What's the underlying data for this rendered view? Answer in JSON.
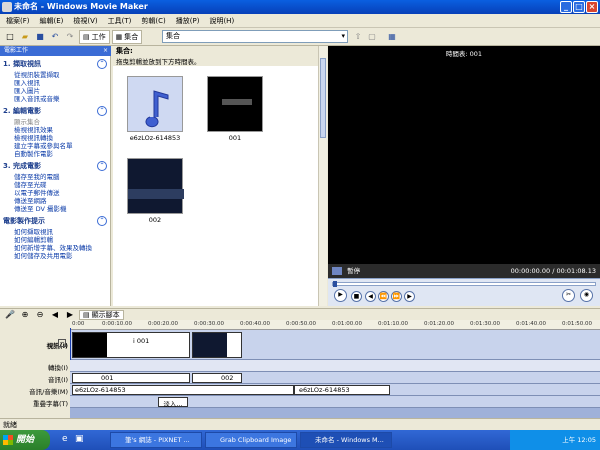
{
  "window": {
    "title": "未命名 - Windows Movie Maker"
  },
  "menu": [
    "檔案(F)",
    "編輯(E)",
    "檢視(V)",
    "工具(T)",
    "剪輯(C)",
    "播放(P)",
    "說明(H)"
  ],
  "toolbar": {
    "tasks_label": "工作",
    "collection_label": "集合",
    "collection_select": "集合"
  },
  "taskpane": {
    "header": "電影工作",
    "sections": [
      {
        "title": "1. 擷取視訊",
        "links": [
          "從視訊裝置擷取",
          "匯入視訊",
          "匯入圖片",
          "匯入音訊或音樂"
        ]
      },
      {
        "title": "2. 編輯電影",
        "links": [
          "顯示集合",
          "檢視視訊效果",
          "檢視視訊轉換",
          "建立字幕或參與名單",
          "自動製作電影"
        ]
      },
      {
        "title": "3. 完成電影",
        "links": [
          "儲存至我的電腦",
          "儲存至光碟",
          "以電子郵件傳送",
          "傳送至網路",
          "傳送至 DV 攝影機"
        ]
      },
      {
        "title": "電影製作提示",
        "links": [
          "如何擷取視訊",
          "如何編輯剪輯",
          "如何新增字幕、效果及轉換",
          "如何儲存及共用電影"
        ]
      }
    ]
  },
  "collection": {
    "header": "集合:",
    "subtitle": "拖曳剪輯並放到下方時間表。",
    "clips": [
      {
        "label": "e6zLOz-614853",
        "kind": "audio"
      },
      {
        "label": "001",
        "kind": "video"
      },
      {
        "label": "002",
        "kind": "video"
      }
    ]
  },
  "monitor": {
    "header": "時間表: 001",
    "status": "暫停",
    "time": "00:00:00.00 / 00:01:08.13"
  },
  "timeline": {
    "show_storyboard": "顯示腳本",
    "ruler": [
      "0:00",
      "0:00:10.00",
      "0:00:20.00",
      "0:00:30.00",
      "0:00:40.00",
      "0:00:50.00",
      "0:01:00.00",
      "0:01:10.00",
      "0:01:20.00",
      "0:01:30.00",
      "0:01:40.00",
      "0:01:50.00"
    ],
    "tracks": {
      "video": "視訊(I)",
      "transition": "轉換(I)",
      "audio": "音訊(I)",
      "audio_music": "音訊/音樂(M)",
      "title_overlay": "重疊字幕(T)"
    },
    "video_clips": [
      "i 001",
      ""
    ],
    "audio_clips": [
      "001",
      "002"
    ],
    "music_clips": [
      "e6zLOz-614853",
      "e6zLOz-614853"
    ],
    "title_clip": "淡入..."
  },
  "statusbar": {
    "text": "就緒"
  },
  "taskbar": {
    "start": "開始",
    "tasks": [
      "筆's 網誌 - PIXNET ...",
      "Grab Clipboard Image",
      "未命名 - Windows M..."
    ],
    "clock": "上午 12:05"
  }
}
